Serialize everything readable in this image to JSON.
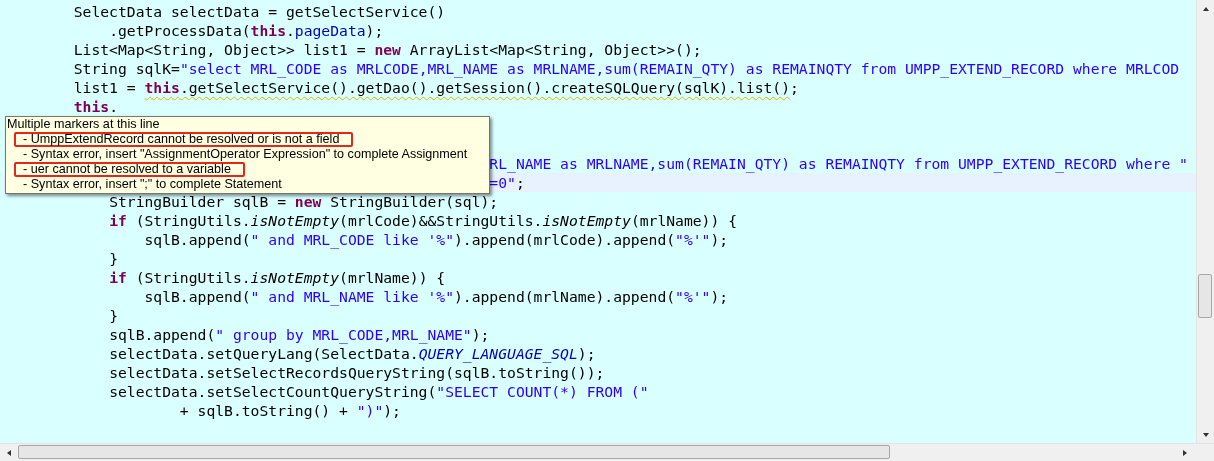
{
  "editor": {
    "lines": [
      {
        "current": false,
        "tokens": [
          {
            "kind": "plain",
            "text": "        SelectData selectData = getSelectService()"
          }
        ]
      },
      {
        "current": false,
        "tokens": [
          {
            "kind": "plain",
            "text": "            .getProcessData("
          },
          {
            "kind": "keyword",
            "text": "this"
          },
          {
            "kind": "plain",
            "text": "."
          },
          {
            "kind": "field",
            "text": "pageData"
          },
          {
            "kind": "plain",
            "text": ");"
          }
        ]
      },
      {
        "current": false,
        "tokens": [
          {
            "kind": "plain",
            "text": "        List<Map<String, Object>> list1 = "
          },
          {
            "kind": "keyword",
            "text": "new"
          },
          {
            "kind": "plain",
            "text": " ArrayList<Map<String, Object>>();"
          }
        ]
      },
      {
        "current": false,
        "tokens": [
          {
            "kind": "plain",
            "text": "        String sqlK="
          },
          {
            "kind": "string",
            "text": "\"select MRL_CODE as MRLCODE,MRL_NAME as MRLNAME,sum(REMAIN_QTY) as REMAINQTY from UMPP_EXTEND_RECORD where MRLCOD"
          }
        ]
      },
      {
        "current": false,
        "tokens": [
          {
            "kind": "plain",
            "text": "        list1 = "
          },
          {
            "kind": "keyword",
            "text": "this",
            "warning": true
          },
          {
            "kind": "plain",
            "text": ".getSelectService().getDao().getSession().createSQLQuery(sqlK).list()",
            "warning": true
          },
          {
            "kind": "plain",
            "text": ";"
          }
        ]
      },
      {
        "current": false,
        "tokens": [
          {
            "kind": "keyword",
            "text": "        this"
          },
          {
            "kind": "plain",
            "text": "."
          }
        ]
      },
      {
        "current": false
      },
      {
        "current": false
      },
      {
        "current": false,
        "tokens": [
          {
            "kind": "string",
            "text": "                                                       RL_NAME as MRLNAME,sum(REMAIN_QTY) as REMAINQTY from UMPP_EXTEND_RECORD where \""
          }
        ]
      },
      {
        "current": true,
        "tokens": [
          {
            "kind": "string",
            "text": "                                                       =0\""
          },
          {
            "kind": "plain",
            "text": ";"
          }
        ]
      },
      {
        "current": false,
        "tokens": [
          {
            "kind": "plain",
            "text": "            StringBuilder sqlB = "
          },
          {
            "kind": "keyword",
            "text": "new"
          },
          {
            "kind": "plain",
            "text": " StringBuilder(sql);"
          }
        ]
      },
      {
        "current": false,
        "tokens": [
          {
            "kind": "keyword",
            "text": "            if"
          },
          {
            "kind": "plain",
            "text": " (StringUtils."
          },
          {
            "kind": "static",
            "text": "isNotEmpty"
          },
          {
            "kind": "plain",
            "text": "(mrlCode)&&StringUtils."
          },
          {
            "kind": "static",
            "text": "isNotEmpty"
          },
          {
            "kind": "plain",
            "text": "(mrlName)) {"
          }
        ]
      },
      {
        "current": false,
        "tokens": [
          {
            "kind": "plain",
            "text": "                sqlB.append("
          },
          {
            "kind": "string",
            "text": "\" and MRL_CODE like '%\""
          },
          {
            "kind": "plain",
            "text": ").append(mrlCode).append("
          },
          {
            "kind": "string",
            "text": "\"%'\""
          },
          {
            "kind": "plain",
            "text": ");"
          }
        ]
      },
      {
        "current": false,
        "tokens": [
          {
            "kind": "plain",
            "text": "            }"
          }
        ]
      },
      {
        "current": false,
        "tokens": [
          {
            "kind": "keyword",
            "text": "            if"
          },
          {
            "kind": "plain",
            "text": " (StringUtils."
          },
          {
            "kind": "static",
            "text": "isNotEmpty"
          },
          {
            "kind": "plain",
            "text": "(mrlName)) {"
          }
        ]
      },
      {
        "current": false,
        "tokens": [
          {
            "kind": "plain",
            "text": "                sqlB.append("
          },
          {
            "kind": "string",
            "text": "\" and MRL_NAME like '%\""
          },
          {
            "kind": "plain",
            "text": ").append(mrlName).append("
          },
          {
            "kind": "string",
            "text": "\"%'\""
          },
          {
            "kind": "plain",
            "text": ");"
          }
        ]
      },
      {
        "current": false,
        "tokens": [
          {
            "kind": "plain",
            "text": "            }"
          }
        ]
      },
      {
        "current": false,
        "tokens": [
          {
            "kind": "plain",
            "text": "            sqlB.append("
          },
          {
            "kind": "string",
            "text": "\" group by MRL_CODE,MRL_NAME\""
          },
          {
            "kind": "plain",
            "text": ");"
          }
        ]
      },
      {
        "current": false,
        "tokens": [
          {
            "kind": "plain",
            "text": "            selectData.setQueryLang(SelectData."
          },
          {
            "kind": "constant",
            "text": "QUERY_LANGUAGE_SQL"
          },
          {
            "kind": "plain",
            "text": ");"
          }
        ]
      },
      {
        "current": false,
        "tokens": [
          {
            "kind": "plain",
            "text": "            selectData.setSelectRecordsQueryString(sqlB.toString());"
          }
        ]
      },
      {
        "current": false,
        "tokens": [
          {
            "kind": "plain",
            "text": "            selectData.setSelectCountQueryString("
          },
          {
            "kind": "string",
            "text": "\"SELECT COUNT(*) FROM (\""
          }
        ]
      },
      {
        "current": false,
        "tokens": [
          {
            "kind": "plain",
            "text": "                    + sqlB.toString() + "
          },
          {
            "kind": "string",
            "text": "\")\""
          },
          {
            "kind": "plain",
            "text": ");"
          }
        ]
      }
    ]
  },
  "tooltip": {
    "title": "Multiple markers at this line",
    "items": [
      {
        "text": "- UmppExtendRecord cannot be resolved or is not a field",
        "highlighted": true
      },
      {
        "text": "- Syntax error, insert \"AssignmentOperator Expression\" to complete Assignment",
        "highlighted": false
      },
      {
        "text": "- uer cannot be resolved to a variable",
        "highlighted": true
      },
      {
        "text": "- Syntax error, insert \";\" to complete Statement",
        "highlighted": false
      }
    ]
  }
}
